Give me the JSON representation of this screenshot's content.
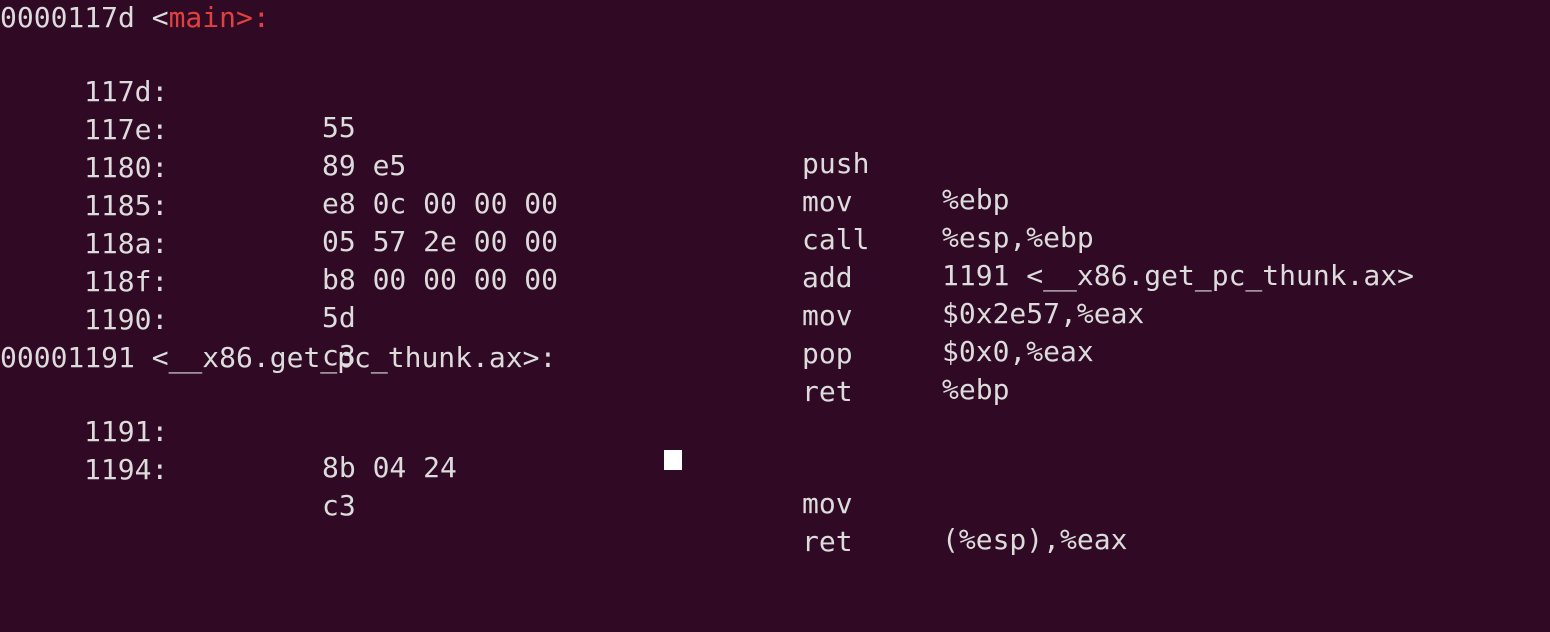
{
  "window": {
    "title": ""
  },
  "colors": {
    "background": "#300a24",
    "text": "#dcdcdc",
    "symbol_highlight": "#e0413f",
    "cursor": "#ffffff"
  },
  "sections": [
    {
      "header_addr": "0000117d",
      "header_open": "<",
      "header_name": "main>:",
      "header_close": "",
      "rows": [
        {
          "addr": "117d:",
          "bytes": "55",
          "mnemonic": "push",
          "operands": "%ebp"
        },
        {
          "addr": "117e:",
          "bytes": "89 e5",
          "mnemonic": "mov",
          "operands": "%esp,%ebp"
        },
        {
          "addr": "1180:",
          "bytes": "e8 0c 00 00 00",
          "mnemonic": "call",
          "operands": "1191 <__x86.get_pc_thunk.ax>"
        },
        {
          "addr": "1185:",
          "bytes": "05 57 2e 00 00",
          "mnemonic": "add",
          "operands": "$0x2e57,%eax"
        },
        {
          "addr": "118a:",
          "bytes": "b8 00 00 00 00",
          "mnemonic": "mov",
          "operands": "$0x0,%eax"
        },
        {
          "addr": "118f:",
          "bytes": "5d",
          "mnemonic": "pop",
          "operands": "%ebp"
        },
        {
          "addr": "1190:",
          "bytes": "c3",
          "mnemonic": "ret",
          "operands": ""
        }
      ]
    },
    {
      "header_addr": "00001191",
      "header_open": "<",
      "header_name": "__x86.get_pc_thunk.ax>:",
      "header_close": "",
      "rows": [
        {
          "addr": "1191:",
          "bytes": "8b 04 24",
          "mnemonic": "mov",
          "operands": "(%esp),%eax"
        },
        {
          "addr": "1194:",
          "bytes": "c3",
          "mnemonic": "ret",
          "operands": ""
        }
      ]
    }
  ]
}
